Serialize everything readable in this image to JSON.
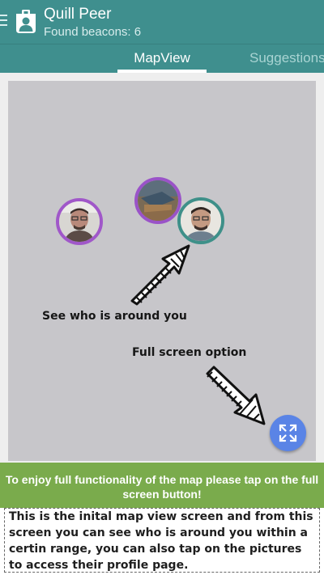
{
  "app": {
    "title": "Quill Peer",
    "subtitle": "Found beacons: 6",
    "menu_icon": "hamburger-icon",
    "logo_icon": "person-badge-icon",
    "toolbar_color": "#3f8f8e"
  },
  "tabs": [
    {
      "label": "MapView",
      "selected": true
    },
    {
      "label": "Suggestions",
      "selected": false
    }
  ],
  "map": {
    "background_color": "#c7c6ca",
    "avatars": [
      {
        "label": "nearby user 1",
        "ring_color": "#a057c9"
      },
      {
        "label": "nearby user 2",
        "ring_color": "#9a53c8"
      },
      {
        "label": "nearby user 3",
        "ring_color": "#3e9089"
      }
    ],
    "annotations": {
      "see_around": "See who is around you",
      "full_screen": "Full screen option"
    },
    "fullscreen_button": {
      "icon": "expand-arrows-icon",
      "color": "#5a84e6"
    }
  },
  "banner": {
    "text": "To enjoy full functionality of the map please tap on the full screen button!",
    "color": "#7aab4c"
  },
  "caption": {
    "text": "This is the inital map view screen and from this screen you can see who is around you within a certin range, you can also tap on the pictures to access their profile page."
  }
}
